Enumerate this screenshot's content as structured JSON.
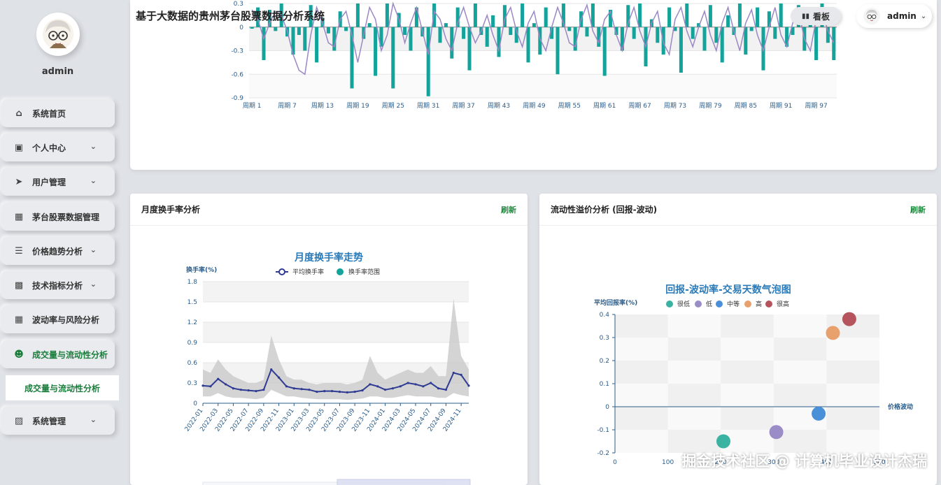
{
  "header": {
    "system_title": "基于大数据的贵州茅台股票数据分析系统",
    "board_label": "看板",
    "user_name": "admin"
  },
  "sidebar": {
    "user_name": "admin",
    "items": [
      {
        "label": "系统首页",
        "icon": "home-icon",
        "has_chevron": false
      },
      {
        "label": "个人中心",
        "icon": "id-card-icon",
        "has_chevron": true
      },
      {
        "label": "用户管理",
        "icon": "send-icon",
        "has_chevron": true
      },
      {
        "label": "茅台股票数据管理",
        "icon": "grid-icon",
        "has_chevron": false
      },
      {
        "label": "价格趋势分析",
        "icon": "sliders-icon",
        "has_chevron": true
      },
      {
        "label": "技术指标分析",
        "icon": "briefcase-icon",
        "has_chevron": true
      },
      {
        "label": "波动率与风险分析",
        "icon": "grid-icon",
        "has_chevron": false
      },
      {
        "label": "成交量与流动性分析",
        "icon": "user-icon",
        "has_chevron": false,
        "active": true
      },
      {
        "label": "系统管理",
        "icon": "clipboard-icon",
        "has_chevron": true
      }
    ],
    "sub_item": "成交量与流动性分析"
  },
  "colors": {
    "accent_green": "#1a8a3c",
    "bar_teal": "#13a39a",
    "line_purple": "#9b87c4",
    "navy_line": "#2f3b93"
  },
  "card_left": {
    "title": "月度换手率分析",
    "refresh": "刷新"
  },
  "card_right": {
    "title": "流动性溢价分析 (回报-波动)",
    "refresh": "刷新"
  },
  "watermark": "掘金技术社区 @ 计算机毕业设计杰瑞",
  "chart_data": [
    {
      "type": "bar",
      "title": "",
      "ylim": [
        -0.9,
        0.3
      ],
      "yticks": [
        0.3,
        0,
        -0.3,
        -0.6,
        -0.9
      ],
      "xtick_labels": [
        "周期 1",
        "周期 7",
        "周期 13",
        "周期 19",
        "周期 25",
        "周期 31",
        "周期 37",
        "周期 43",
        "周期 49",
        "周期 55",
        "周期 61",
        "周期 67",
        "周期 73",
        "周期 79",
        "周期 85",
        "周期 91",
        "周期 97"
      ],
      "bar_values": [
        -0.02,
        0.25,
        -0.42,
        0.22,
        -0.05,
        0.3,
        -0.12,
        -0.35,
        -0.1,
        -0.3,
        0.28,
        -0.45,
        0.12,
        -0.08,
        -0.3,
        0.2,
        -0.05,
        -0.78,
        0.3,
        -0.15,
        0.05,
        -0.62,
        -0.25,
        0.3,
        -0.78,
        0.18,
        -0.1,
        -0.3,
        0.25,
        -0.12,
        -0.88,
        0.3,
        -0.2,
        0.05,
        -0.4,
        0.25,
        -0.15,
        -0.55,
        0.3,
        -0.1,
        -0.25,
        0.15,
        -0.38,
        0.28,
        -0.1,
        -0.2,
        0.3,
        -0.45,
        0.05,
        -0.35,
        0.25,
        -0.15,
        -0.6,
        0.3,
        -0.05,
        -0.3,
        0.2,
        -0.12,
        0.3,
        -0.25,
        -0.62,
        0.22,
        -0.1,
        -0.3,
        0.28,
        -0.15,
        0.3,
        -0.5,
        0.1,
        -0.2,
        -0.35,
        0.25,
        -0.05,
        -0.58,
        0.3,
        -0.15,
        0.05,
        -0.3,
        0.28,
        -0.2,
        -0.45,
        0.15,
        -0.1,
        0.3,
        -0.35,
        -0.05,
        0.25,
        -0.55,
        0.2,
        -0.15,
        0.3,
        -0.25,
        -0.1,
        0.28,
        -0.3,
        0.05,
        -0.42,
        0.3,
        -0.2,
        -0.42
      ],
      "line_values": [
        0.22,
        0.1,
        -0.15,
        0.05,
        0.2,
        0.15,
        -0.05,
        -0.35,
        -0.55,
        -0.6,
        -0.1,
        0.25,
        0.05,
        -0.2,
        -0.25,
        0.1,
        0.2,
        -0.1,
        -0.45,
        -0.1,
        0.25,
        0.1,
        -0.3,
        -0.1,
        0.3,
        0.1,
        -0.2,
        0.05,
        0.25,
        -0.05,
        -0.35,
        0.2,
        0.1,
        -0.15,
        -0.3,
        0.05,
        0.25,
        0.0,
        -0.2,
        -0.05,
        0.15,
        -0.1,
        -0.3,
        0.1,
        0.25,
        -0.05,
        -0.25,
        0.05,
        0.2,
        -0.15,
        -0.3,
        0.0,
        0.25,
        0.05,
        -0.2,
        -0.25,
        0.1,
        0.28,
        -0.05,
        -0.2,
        0.1,
        0.2,
        -0.1,
        -0.3,
        0.05,
        0.25,
        -0.05,
        -0.25,
        0.05,
        0.2,
        -0.2,
        -0.35,
        0.1,
        0.25,
        -0.05,
        -0.25,
        0.0,
        0.2,
        -0.1,
        -0.3,
        0.05,
        0.25,
        -0.05,
        -0.3,
        0.05,
        0.22,
        -0.1,
        -0.3,
        0.0,
        0.25,
        -0.1,
        -0.25,
        0.05,
        0.2,
        -0.15,
        -0.3,
        0.1,
        0.2,
        -0.05,
        -0.2
      ]
    },
    {
      "type": "line",
      "title": "月度换手率走势",
      "ylabel": "换手率(%)",
      "ylim": [
        0,
        1.8
      ],
      "yticks": [
        0,
        0.3,
        0.6,
        0.9,
        1.2,
        1.5,
        1.8
      ],
      "legend": [
        "平均换手率",
        "换手率范围"
      ],
      "categories": [
        "2022-01",
        "2022-02",
        "2022-03",
        "2022-04",
        "2022-05",
        "2022-06",
        "2022-07",
        "2022-08",
        "2022-09",
        "2022-10",
        "2022-11",
        "2022-12",
        "2023-01",
        "2023-02",
        "2023-03",
        "2023-04",
        "2023-05",
        "2023-06",
        "2023-07",
        "2023-08",
        "2023-09",
        "2023-10",
        "2023-11",
        "2023-12",
        "2024-01",
        "2024-02",
        "2024-03",
        "2024-04",
        "2024-05",
        "2024-06",
        "2024-07",
        "2024-08",
        "2024-09",
        "2024-10",
        "2024-11",
        "2024-12"
      ],
      "xtick_labels": [
        "2022-01",
        "2022-03",
        "2022-05",
        "2022-07",
        "2022-09",
        "2022-11",
        "2023-01",
        "2023-03",
        "2023-05",
        "2023-07",
        "2023-09",
        "2023-11",
        "2024-01",
        "2024-03",
        "2024-05",
        "2024-07",
        "2024-09",
        "2024-11"
      ],
      "avg": [
        0.26,
        0.25,
        0.36,
        0.28,
        0.22,
        0.2,
        0.19,
        0.18,
        0.2,
        0.5,
        0.38,
        0.25,
        0.22,
        0.21,
        0.2,
        0.17,
        0.18,
        0.18,
        0.17,
        0.16,
        0.17,
        0.19,
        0.28,
        0.25,
        0.2,
        0.22,
        0.25,
        0.3,
        0.28,
        0.25,
        0.3,
        0.22,
        0.2,
        0.45,
        0.42,
        0.26
      ],
      "range_low": [
        0.1,
        0.1,
        0.15,
        0.1,
        0.08,
        0.08,
        0.07,
        0.06,
        0.08,
        0.2,
        0.15,
        0.1,
        0.1,
        0.08,
        0.07,
        0.06,
        0.06,
        0.06,
        0.06,
        0.05,
        0.06,
        0.07,
        0.1,
        0.1,
        0.08,
        0.08,
        0.1,
        0.12,
        0.1,
        0.1,
        0.1,
        0.08,
        0.08,
        0.15,
        0.12,
        0.1
      ],
      "range_high": [
        0.5,
        0.45,
        0.65,
        0.5,
        0.4,
        0.35,
        0.3,
        0.3,
        0.35,
        1.0,
        0.65,
        0.4,
        0.35,
        0.35,
        0.3,
        0.28,
        0.3,
        0.3,
        0.3,
        0.28,
        0.3,
        0.35,
        0.7,
        0.45,
        0.35,
        0.4,
        0.45,
        0.5,
        0.45,
        0.45,
        0.55,
        0.4,
        0.4,
        1.55,
        0.7,
        0.5
      ]
    },
    {
      "type": "scatter",
      "title": "回报-波动率-交易天数气泡图",
      "ylabel": "平均回报率(%)",
      "xlabel": "价格波动",
      "ylim": [
        -0.2,
        0.4
      ],
      "xlim": [
        0,
        500
      ],
      "yticks": [
        0.4,
        0.3,
        0.2,
        0.1,
        0,
        -0.1,
        -0.2
      ],
      "xticks": [
        0,
        100,
        200,
        300,
        400,
        500
      ],
      "legend": [
        {
          "name": "很低",
          "color": "#3bb3a3"
        },
        {
          "name": "低",
          "color": "#9a8cc6"
        },
        {
          "name": "中等",
          "color": "#4a90d9"
        },
        {
          "name": "高",
          "color": "#e8a06c"
        },
        {
          "name": "很高",
          "color": "#b5545c"
        }
      ],
      "points": [
        {
          "x": 205,
          "y": -0.15,
          "group": "很低"
        },
        {
          "x": 305,
          "y": -0.11,
          "group": "低"
        },
        {
          "x": 385,
          "y": -0.03,
          "group": "中等"
        },
        {
          "x": 412,
          "y": 0.32,
          "group": "高"
        },
        {
          "x": 443,
          "y": 0.38,
          "group": "很高"
        }
      ]
    }
  ]
}
